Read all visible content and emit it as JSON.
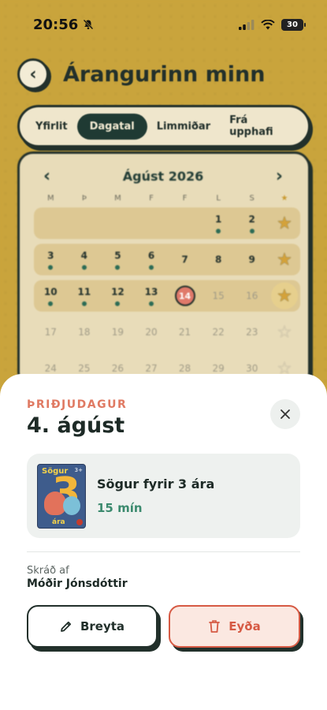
{
  "status": {
    "time": "20:56",
    "battery": "30"
  },
  "header": {
    "title": "Árangurinn minn"
  },
  "tabs": [
    "Yfirlit",
    "Dagatal",
    "Limmiðar",
    "Frá upphafi"
  ],
  "calendar": {
    "month": "Ágúst 2026",
    "weekdays": [
      "M",
      "Þ",
      "M",
      "F",
      "F",
      "L",
      "S"
    ],
    "weeks": [
      {
        "days": [
          "",
          "",
          "",
          "",
          "",
          "1",
          "2"
        ],
        "dots": [
          false,
          false,
          false,
          false,
          false,
          true,
          true
        ],
        "star": "filled"
      },
      {
        "days": [
          "3",
          "4",
          "5",
          "6",
          "7",
          "8",
          "9"
        ],
        "dots": [
          true,
          true,
          true,
          true,
          false,
          false,
          false
        ],
        "star": "filled"
      },
      {
        "days": [
          "10",
          "11",
          "12",
          "13",
          "14",
          "15",
          "16"
        ],
        "dots": [
          true,
          true,
          true,
          true,
          false,
          false,
          false
        ],
        "star": "filled-circle",
        "today": "14"
      },
      {
        "days": [
          "17",
          "18",
          "19",
          "20",
          "21",
          "22",
          "23"
        ],
        "dots": [
          false,
          false,
          false,
          false,
          false,
          false,
          false
        ],
        "star": "empty"
      },
      {
        "days": [
          "24",
          "25",
          "26",
          "27",
          "28",
          "29",
          "30"
        ],
        "dots": [
          false,
          false,
          false,
          false,
          false,
          false,
          false
        ],
        "star": "empty"
      }
    ]
  },
  "sheet": {
    "day_of_week": "ÞRIÐJUDAGUR",
    "date": "4. ágúst",
    "book": {
      "title": "Sögur fyrir 3 ára",
      "duration": "15 mín",
      "cover_title": "Sögur",
      "cover_number": "3",
      "cover_subtitle": "ára",
      "cover_badge": "3+"
    },
    "logged_by_label": "Skráð af",
    "logged_by_name": "Móðir Jónsdóttir",
    "edit_label": "Breyta",
    "delete_label": "Eyða"
  }
}
